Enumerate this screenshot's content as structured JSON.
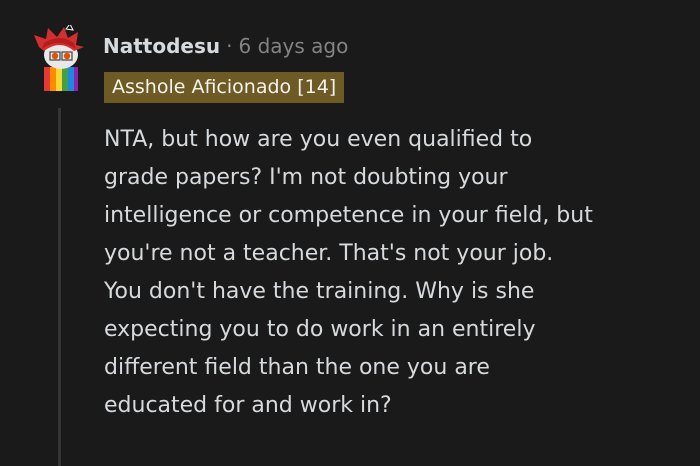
{
  "comment": {
    "author": "Nattodesu",
    "separator": "·",
    "timestamp": "6 days ago",
    "flair": "Asshole Aficionado [14]",
    "body_lines": [
      "NTA, but how are you even qualified to",
      "grade papers? I'm not doubting your",
      "intelligence or competence in your field, but",
      "you're not a teacher. That's not your job.",
      "You don't have the training. Why is she",
      "expecting you to do work in an entirely",
      "different field than the one you are",
      "educated for and work in?"
    ]
  },
  "colors": {
    "background": "#1a1a1b",
    "text": "#d7dadc",
    "meta": "#818384",
    "flair_background": "#6d5a25",
    "thread_line": "#343536"
  },
  "icons": {
    "avatar": "snoo-avatar-red-hair-rainbow-sweater"
  }
}
